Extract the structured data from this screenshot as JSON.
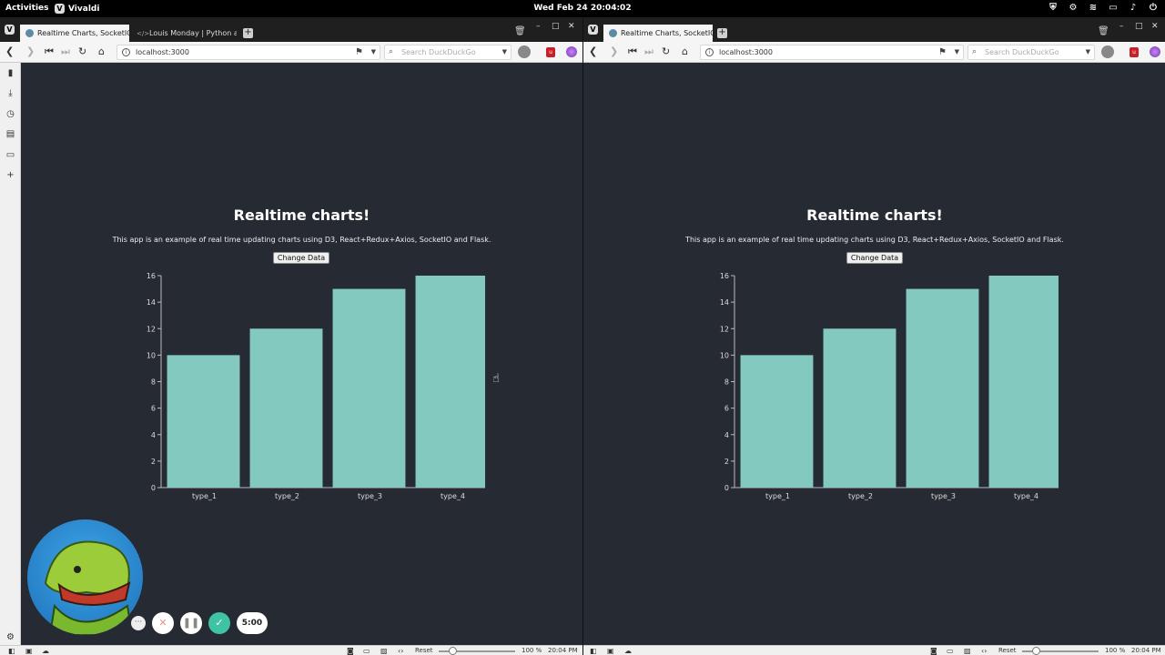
{
  "system": {
    "activities": "Activities",
    "app_name": "Vivaldi",
    "clock": "Wed Feb 24  20:04:02"
  },
  "left_window": {
    "tabs": [
      {
        "label": "Realtime Charts, SocketIO"
      },
      {
        "label": "Louis Monday | Python an"
      }
    ],
    "url": "localhost:3000",
    "search_placeholder": "Search DuckDuckGo",
    "status": {
      "reset": "Reset",
      "zoom": "100 %",
      "time": "20:04 PM"
    }
  },
  "right_window": {
    "tabs": [
      {
        "label": "Realtime Charts, SocketIO"
      }
    ],
    "url": "localhost:3000",
    "search_placeholder": "Search DuckDuckGo",
    "status": {
      "reset": "Reset",
      "zoom": "100 %",
      "time": "20:04 PM"
    }
  },
  "content": {
    "title": "Realtime charts!",
    "description": "This app is an example of real time updating charts using D3, React+Redux+Axios, SocketIO and Flask.",
    "button_label": "Change Data"
  },
  "recorder": {
    "timer": "5:00"
  },
  "chart_data": {
    "type": "bar",
    "categories": [
      "type_1",
      "type_2",
      "type_3",
      "type_4"
    ],
    "values": [
      10,
      12,
      15,
      16
    ],
    "yticks": [
      "0",
      "2",
      "4",
      "6",
      "8",
      "10",
      "12",
      "14",
      "16"
    ],
    "ylim": [
      0,
      16
    ],
    "bar_color": "#84c9bf",
    "grid": false
  }
}
